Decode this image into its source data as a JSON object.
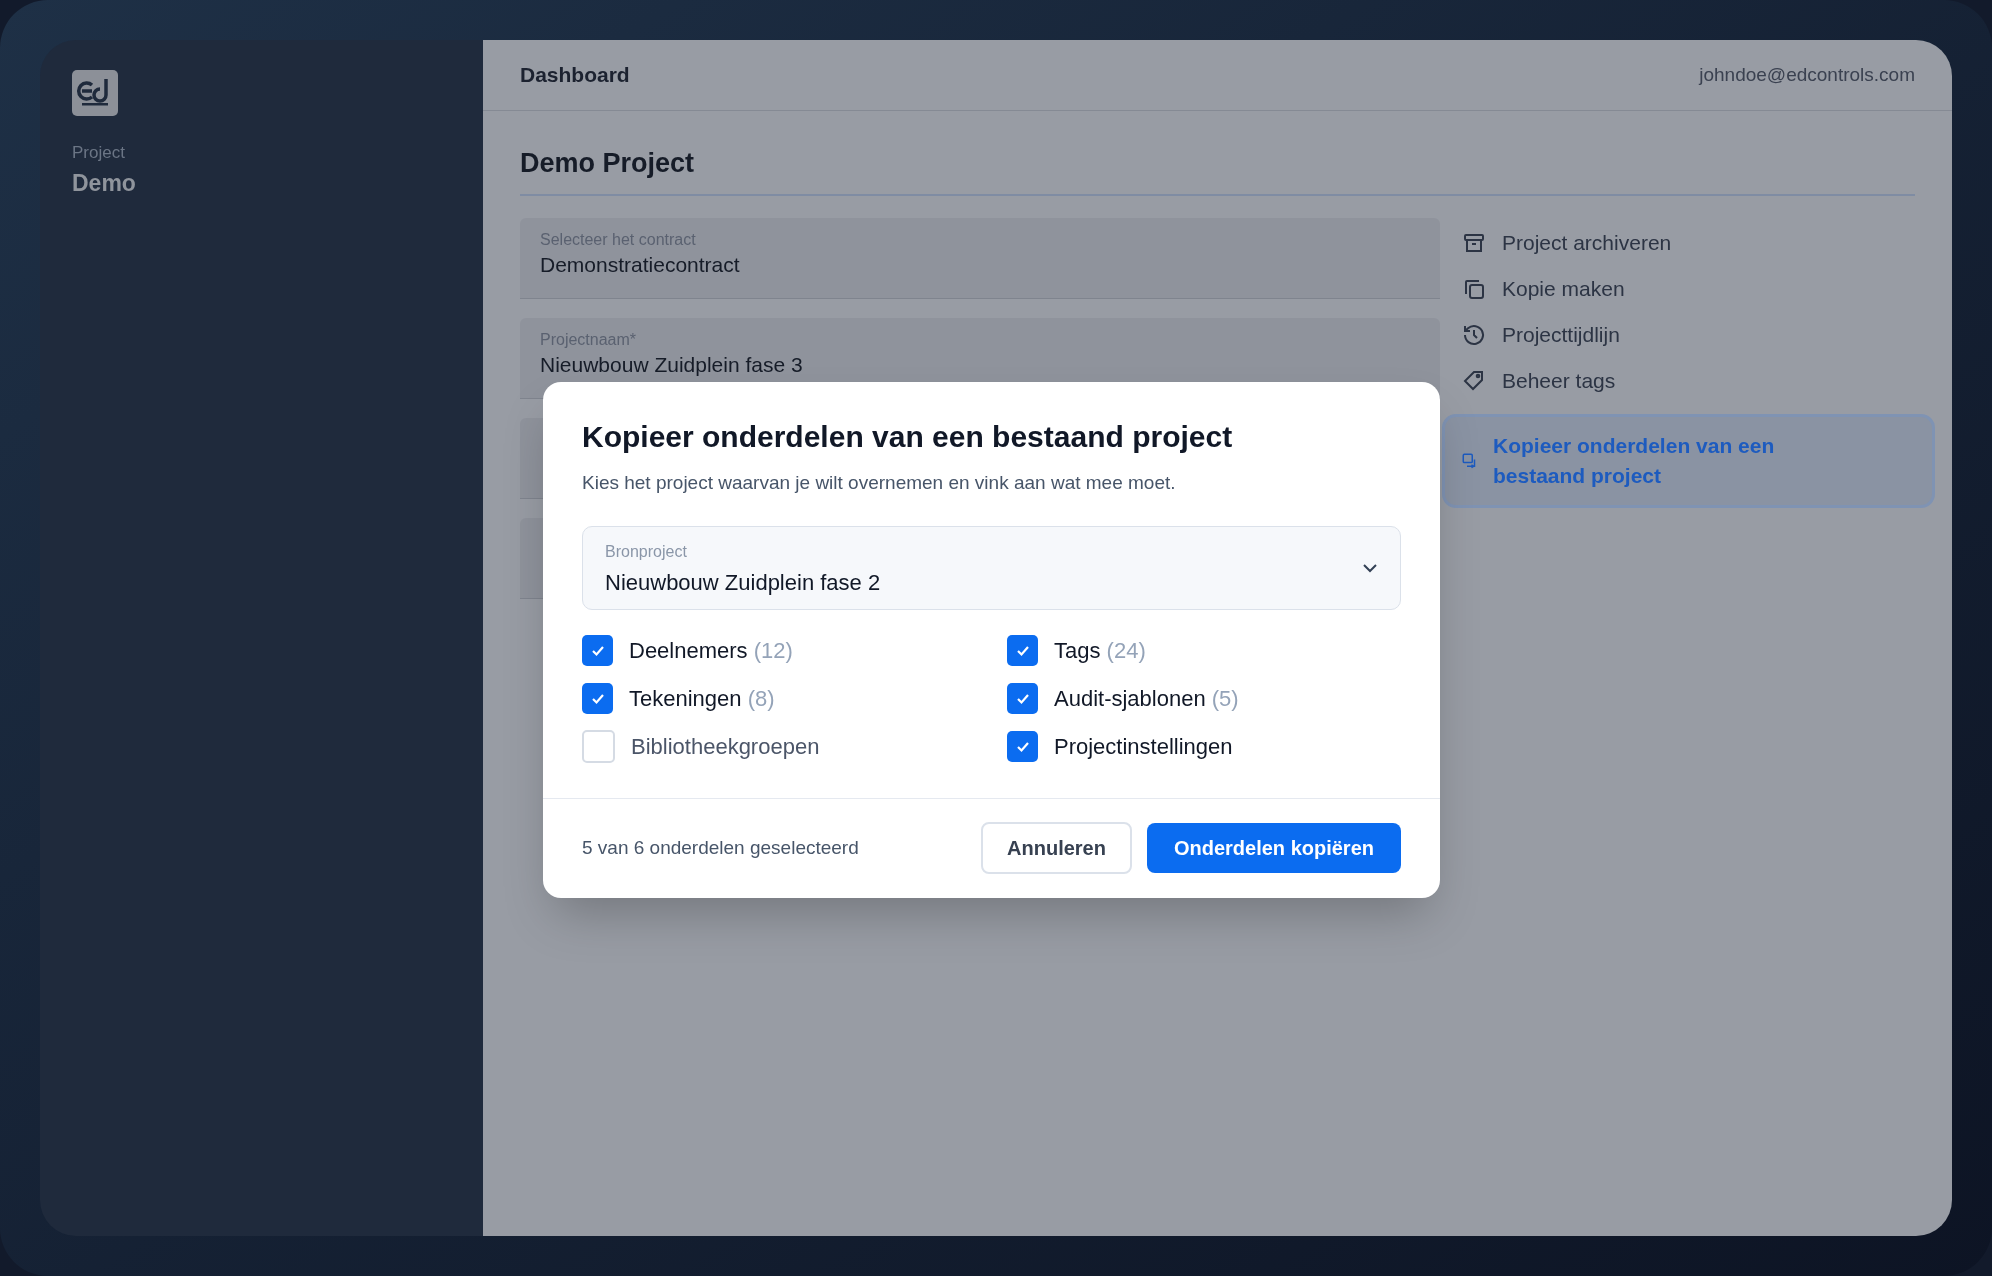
{
  "sidebar": {
    "project_label": "Project",
    "project_name": "Demo"
  },
  "header": {
    "title": "Dashboard",
    "user_email": "johndoe@edcontrols.com"
  },
  "page": {
    "title": "Demo Project",
    "fields": [
      {
        "label": "Selecteer het contract",
        "value": "Demonstratiecontract"
      },
      {
        "label": "Projectnaam*",
        "value": "Nieuwbouw Zuidplein fase 3"
      }
    ]
  },
  "actions": [
    {
      "kind": "archive",
      "label": "Project archiveren",
      "selected": false
    },
    {
      "kind": "copy",
      "label": "Kopie maken",
      "selected": false
    },
    {
      "kind": "history",
      "label": "Projecttijdlijn",
      "selected": false
    },
    {
      "kind": "tag",
      "label": "Beheer tags",
      "selected": false
    },
    {
      "kind": "copy-parts",
      "label": "Kopieer onderdelen van een bestaand project",
      "selected": true
    }
  ],
  "dialog": {
    "title": "Kopieer onderdelen van een bestaand project",
    "subtitle": "Kies het project waarvan je wilt overnemen en vink aan wat mee moet.",
    "source": {
      "label": "Bronproject",
      "value": "Nieuwbouw Zuidplein fase 2"
    },
    "options": [
      {
        "label": "Deelnemers",
        "count": "(12)",
        "checked": true
      },
      {
        "label": "Tags",
        "count": "(24)",
        "checked": true
      },
      {
        "label": "Tekeningen",
        "count": "(8)",
        "checked": true
      },
      {
        "label": "Audit-sjablonen",
        "count": "(5)",
        "checked": true
      },
      {
        "label": "Bibliotheekgroepen",
        "checked": false
      },
      {
        "label": "Projectinstellingen",
        "checked": true
      }
    ],
    "summary": "5 van 6 onderdelen geselecteerd",
    "buttons": [
      {
        "kind": "secondary",
        "label": "Annuleren"
      },
      {
        "kind": "primary",
        "label": "Onderdelen kopiëren"
      }
    ]
  }
}
